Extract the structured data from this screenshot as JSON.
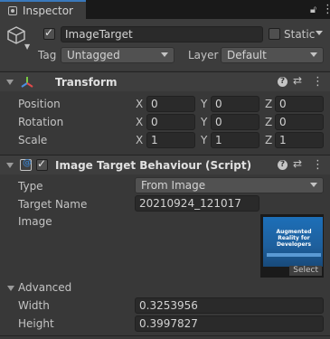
{
  "tab": {
    "title": "Inspector"
  },
  "header": {
    "object_name": "ImageTarget",
    "static_label": "Static",
    "tag_label": "Tag",
    "tag_value": "Untagged",
    "layer_label": "Layer",
    "layer_value": "Default",
    "active": true,
    "static": false
  },
  "transform": {
    "title": "Transform",
    "rows": [
      {
        "label": "Position",
        "x": "0",
        "y": "0",
        "z": "0"
      },
      {
        "label": "Rotation",
        "x": "0",
        "y": "0",
        "z": "0"
      },
      {
        "label": "Scale",
        "x": "1",
        "y": "1",
        "z": "1"
      }
    ],
    "axis": {
      "x": "X",
      "y": "Y",
      "z": "Z"
    }
  },
  "itb": {
    "title": "Image Target Behaviour (Script)",
    "type_label": "Type",
    "type_value": "From Image",
    "target_name_label": "Target Name",
    "target_name_value": "20210924_121017",
    "image_label": "Image",
    "thumb_title": "Augmented Reality for Developers",
    "thumb_select": "Select",
    "advanced_label": "Advanced",
    "width_label": "Width",
    "width_value": "0.3253956",
    "height_label": "Height",
    "height_value": "0.3997827"
  },
  "colors": {
    "accent": "#3a79bb",
    "background": "#383838"
  }
}
